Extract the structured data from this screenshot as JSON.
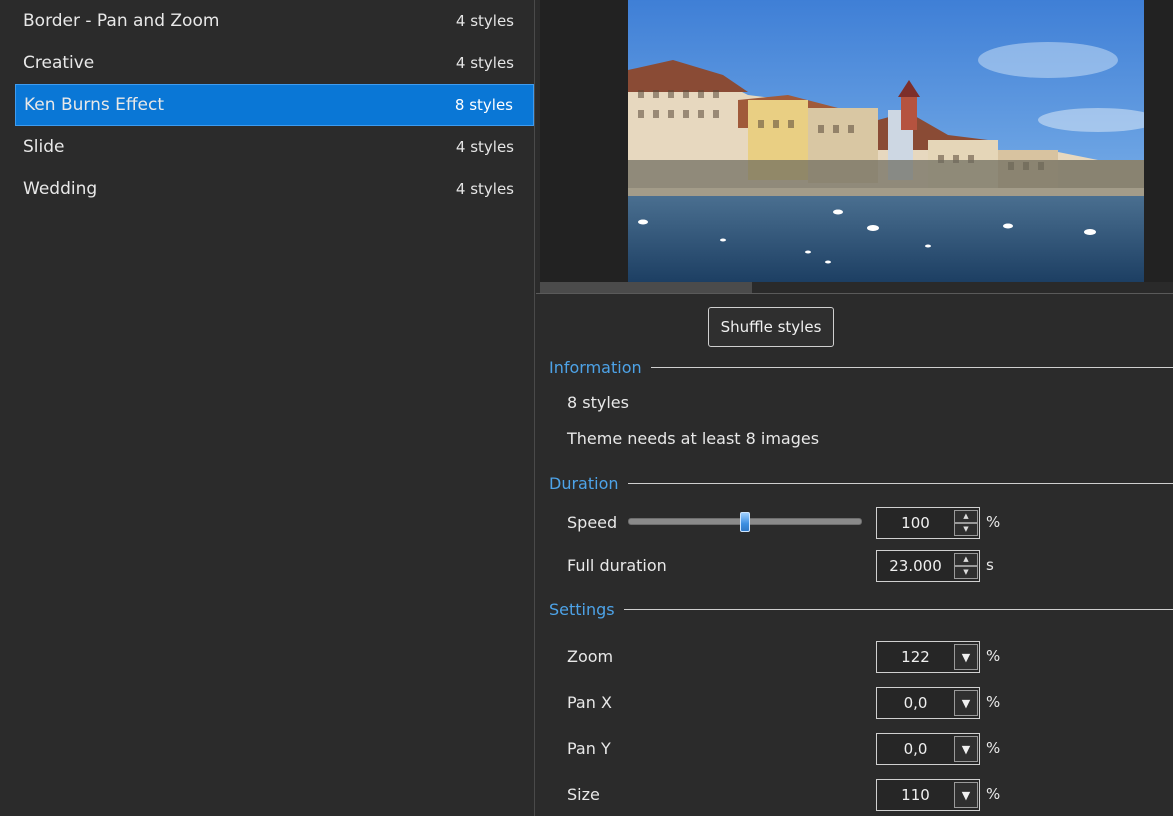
{
  "theme_list": {
    "items": [
      {
        "name": "Border - Pan and Zoom",
        "count": "4 styles"
      },
      {
        "name": "Creative",
        "count": "4 styles"
      },
      {
        "name": "Ken Burns Effect",
        "count": "8 styles",
        "selected": true
      },
      {
        "name": "Slide",
        "count": "4 styles"
      },
      {
        "name": "Wedding",
        "count": "4 styles"
      }
    ]
  },
  "toolbar": {
    "shuffle_label": "Shuffle styles"
  },
  "information": {
    "title": "Information",
    "styles_count": "8 styles",
    "requirement": "Theme needs at least 8 images"
  },
  "duration": {
    "title": "Duration",
    "speed_label": "Speed",
    "speed_value": "100",
    "speed_unit": "%",
    "speed_slider_fraction": 0.5,
    "full_duration_label": "Full duration",
    "full_duration_value": "23.000",
    "full_duration_unit": "s"
  },
  "settings": {
    "title": "Settings",
    "zoom_label": "Zoom",
    "zoom_value": "122",
    "zoom_unit": "%",
    "pan_x_label": "Pan X",
    "pan_x_value": "0,0",
    "pan_x_unit": "%",
    "pan_y_label": "Pan Y",
    "pan_y_value": "0,0",
    "pan_y_unit": "%",
    "size_label": "Size",
    "size_value": "110",
    "size_unit": "%"
  },
  "icons": {
    "spin_up": "triangle-up-icon",
    "spin_down": "triangle-down-icon",
    "dropdown": "chevron-down-icon"
  },
  "colors": {
    "accent": "#0a77d6",
    "section_title": "#4da3e8",
    "background": "#2b2b2b"
  }
}
